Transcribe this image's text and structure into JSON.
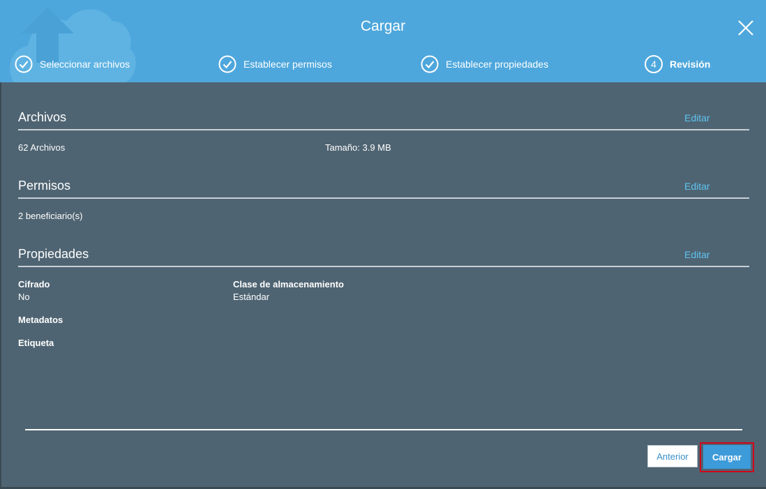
{
  "dialog": {
    "title": "Cargar"
  },
  "steps": [
    {
      "label": "Seleccionar archivos",
      "state": "done"
    },
    {
      "label": "Establecer permisos",
      "state": "done"
    },
    {
      "label": "Establecer propiedades",
      "state": "done"
    },
    {
      "label": "Revisión",
      "number": "4",
      "state": "active"
    }
  ],
  "files": {
    "title": "Archivos",
    "edit": "Editar",
    "count": "62 Archivos",
    "size": "Tamaño: 3.9 MB"
  },
  "permissions": {
    "title": "Permisos",
    "edit": "Editar",
    "grantees": "2 beneficiario(s)"
  },
  "properties": {
    "title": "Propiedades",
    "edit": "Editar",
    "encryption_label": "Cifrado",
    "encryption_value": "No",
    "storage_class_label": "Clase de almacenamiento",
    "storage_class_value": "Estándar",
    "metadata_label": "Metadatos",
    "tag_label": "Etiqueta"
  },
  "footer": {
    "previous": "Anterior",
    "upload": "Cargar"
  },
  "colors": {
    "header": "#4ea7dc",
    "body": "#4f6472",
    "link": "#5ec4f2",
    "primary_button": "#3d9bd9",
    "highlight": "#d0021b"
  }
}
